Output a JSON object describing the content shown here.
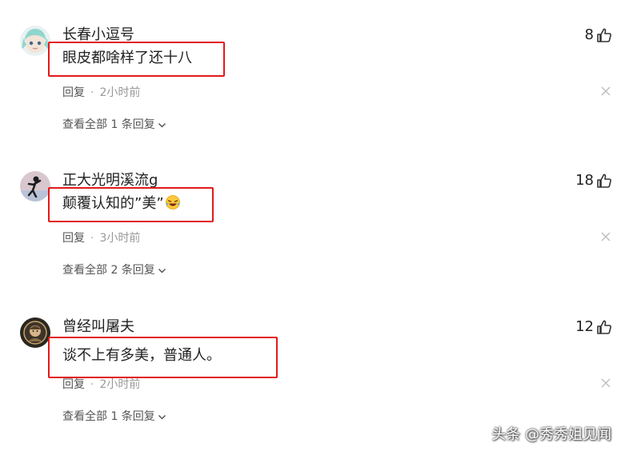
{
  "comments": [
    {
      "username": "长春小逗号",
      "text": "眼皮都啥样了还十八",
      "likes": "8",
      "reply_label": "回复",
      "time": "2小时前",
      "view_replies": "查看全部 1 条回复"
    },
    {
      "username": "正大光明溪流g",
      "text": "颠覆认知的”美”",
      "likes": "18",
      "reply_label": "回复",
      "time": "3小时前",
      "view_replies": "查看全部 2 条回复"
    },
    {
      "username": "曾经叫屠夫",
      "text": "谈不上有多美，普通人。",
      "likes": "12",
      "reply_label": "回复",
      "time": "2小时前",
      "view_replies": "查看全部 1 条回复"
    }
  ],
  "icons": {
    "like": "thumbs-up-icon",
    "close": "close-icon",
    "expand": "chevron-down-icon",
    "emoji": "laughing-emoji-icon"
  },
  "watermark": "头条 @秀秀姐见闻",
  "colors": {
    "highlight_box": "#e11a1a",
    "meta_text": "#999999",
    "text": "#222222"
  }
}
